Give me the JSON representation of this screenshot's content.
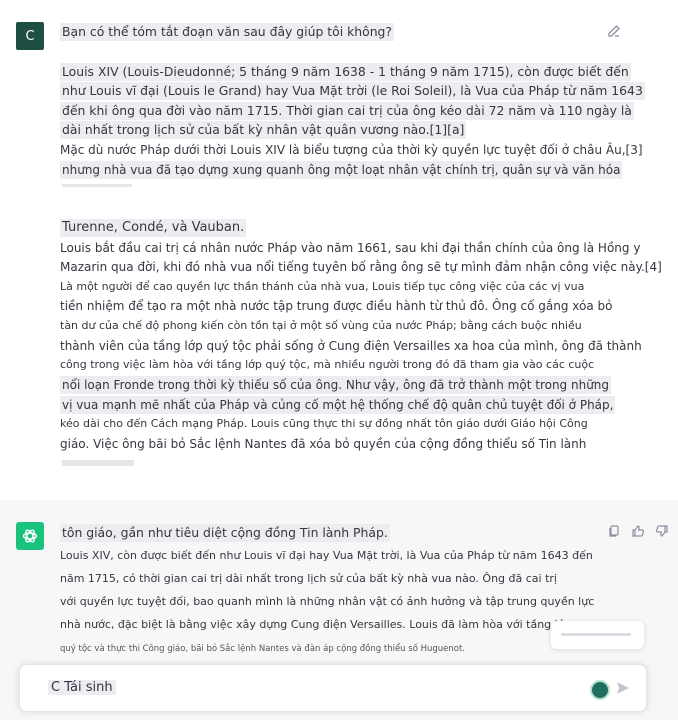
{
  "user": {
    "avatar_letter": "C",
    "question": "Bạn có thể tóm tắt đoạn văn sau đây giúp tôi không?",
    "lines": [
      "Louis XIV (Louis-Dieudonné; 5 tháng 9 năm 1638 - 1 tháng 9 năm 1715), còn được biết đến",
      " như Louis vĩ đại (Louis le Grand) hay Vua Mặt trời (le Roi Soleil), là Vua của Pháp từ năm 1643",
      "đến khi ông qua đời vào năm 1715. Thời gian cai trị của ông kéo dài 72 năm và 110 ngày là",
      "dài nhất trong lịch sử của bất kỳ nhân vật quân vương nào.[1][a]",
      "Mặc dù nước Pháp dưới thời Louis XIV là biểu tượng của thời kỳ quyền lực tuyệt đối ở châu Âu,[3]",
      " nhưng nhà vua đã tạo dựng xung quanh ông một loạt nhân vật chính trị, quân sự và văn hóa",
      "Turenne, Condé, và Vauban.",
      "Louis bắt đầu cai trị cá nhân nước Pháp vào năm 1661, sau khi đại thần chính của ông là Hồng y",
      "Mazarin qua đời, khi đó nhà vua nổi tiếng tuyên bố rằng ông sẽ tự mình đảm nhận công việc này.[4]",
      "Là một người để cao quyền lực thần thánh của nhà vua, Louis tiếp tục công việc của các vị vua",
      "tiền nhiệm để tạo ra một nhà nước tập trung được điều hành từ thủ đô. Ông cố gắng xóa bỏ",
      "tàn dư của chế độ phong kiến còn tồn tại ở một số vùng của nước Pháp; bằng cách buộc nhiều",
      "thành viên của tầng lớp quý tộc phải sống ở Cung điện Versailles xa hoa của mình, ông đã thành",
      "công trong việc làm hòa với tầng lớp quý tộc, mà nhiều người trong đó đã tham gia vào các cuộc",
      "nổi loạn Fronde trong thời kỳ thiếu số của ông. Như vậy, ông đã trở thành một trong những",
      "vị vua mạnh mẽ nhất của Pháp và củng cố một hệ thống chế độ quân chủ tuyệt đối ở Pháp,",
      "kéo dài cho đến Cách mạng Pháp. Louis cũng thực thi sự đồng nhất tôn giáo dưới Giáo hội Công",
      "giáo. Việc ông bãi bỏ Sắc lệnh Nantes đã xóa bỏ quyền của cộng đồng thiểu số Tin lành"
    ]
  },
  "assistant": {
    "lines": [
      "tôn giáo, gần như tiêu diệt cộng đồng Tin lành Pháp.",
      " Louis XIV, còn được biết đến như Louis vĩ đại hay Vua Mặt trời, là Vua của Pháp từ năm 1643 đến",
      "năm 1715, có thời gian cai trị dài nhất trong lịch sử của bất kỳ nhà vua nào. Ông đã cai trị",
      "với quyền lực tuyệt đối, bao quanh mình là những nhân vật có ảnh hưởng và tập trung quyền lực",
      " nhà nước, đặc biệt là bằng việc xây dựng Cung điện Versailles. Louis đã làm hòa với tầng lớp",
      "quý tộc và thực thi Công giáo, bãi bỏ Sắc lệnh Nantes và đàn áp cộng đồng thiểu số Huguenot."
    ]
  },
  "input": {
    "text": "C Tái sinh"
  },
  "icons": {
    "edit": "edit-icon",
    "copy": "copy-icon",
    "thumbs_up": "thumbs-up-icon",
    "thumbs_down": "thumbs-down-icon",
    "send": "send-icon",
    "bot_logo": "openai-logo-icon"
  },
  "colors": {
    "user_avatar": "#1f4e43",
    "bot_avatar": "#19c37d",
    "assistant_bg": "#f7f7f8",
    "highlight": "#ececf1"
  }
}
